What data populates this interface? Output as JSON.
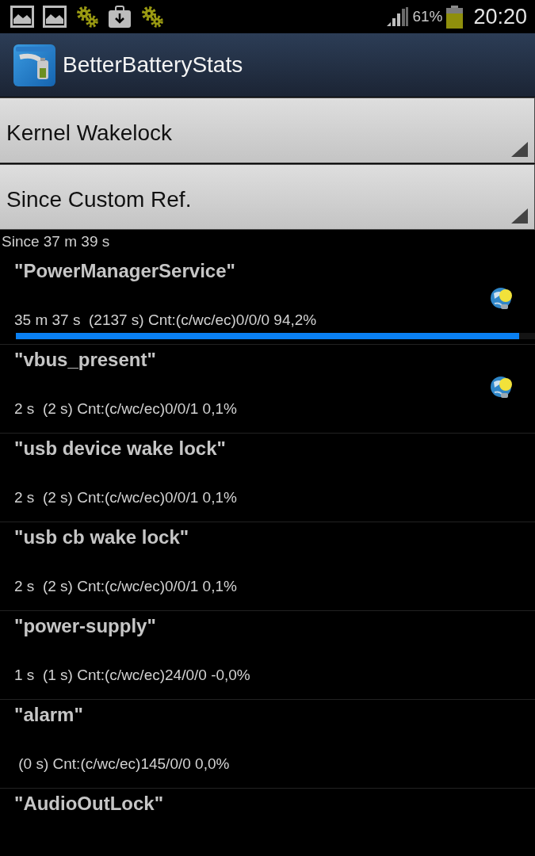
{
  "status_bar": {
    "battery_percent": "61%",
    "time": "20:20"
  },
  "app_bar": {
    "title": "BetterBatteryStats"
  },
  "spinners": [
    {
      "value": "Kernel Wakelock"
    },
    {
      "value": "Since Custom Ref."
    }
  ],
  "since": "Since 37 m 39 s",
  "wakelocks": [
    {
      "name": "\"PowerManagerService\"",
      "details": "35 m 37 s  (2137 s) Cnt:(c/wc/ec)0/0/0 94,2%",
      "show_icon": true,
      "level": 0.97
    },
    {
      "name": "\"vbus_present\"",
      "details": "2 s  (2 s) Cnt:(c/wc/ec)0/0/1 0,1%",
      "show_icon": true
    },
    {
      "name": "\"usb device wake lock\"",
      "details": "2 s  (2 s) Cnt:(c/wc/ec)0/0/1 0,1%",
      "show_icon": false
    },
    {
      "name": "\"usb cb wake lock\"",
      "details": "2 s  (2 s) Cnt:(c/wc/ec)0/0/1 0,1%",
      "show_icon": false
    },
    {
      "name": "\"power-supply\"",
      "details": "1 s  (1 s) Cnt:(c/wc/ec)24/0/0 -0,0%",
      "show_icon": false
    },
    {
      "name": "\"alarm\"",
      "details": " (0 s) Cnt:(c/wc/ec)145/0/0 0,0%",
      "show_icon": false
    },
    {
      "name": "\"AudioOutLock\"",
      "show_icon": false
    }
  ]
}
